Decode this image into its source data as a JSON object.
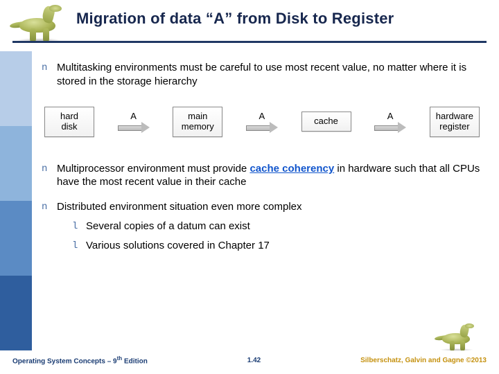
{
  "header": {
    "title": "Migration of data “A” from Disk to Register"
  },
  "bullets": [
    {
      "marker": "n",
      "text": "Multitasking environments must be careful to use most recent value, no matter where it is stored in the storage hierarchy"
    },
    {
      "marker": "n",
      "text_before": "Multiprocessor environment must provide ",
      "link": "cache coherency",
      "text_after": " in hardware such that all CPUs have the most recent value in their cache"
    },
    {
      "marker": "n",
      "text": "Distributed environment situation even more complex",
      "subs": [
        {
          "marker": "l",
          "text": "Several copies of a datum can exist"
        },
        {
          "marker": "l",
          "text": "Various solutions covered in Chapter 17"
        }
      ]
    }
  ],
  "diagram": {
    "boxes": [
      "hard\ndisk",
      "main\nmemory",
      "cache",
      "hardware\nregister"
    ],
    "arrow_label": "A"
  },
  "footer": {
    "left_prefix": "Operating System Concepts – 9",
    "left_super": "th",
    "left_suffix": " Edition",
    "center": "1.42",
    "right": "Silberschatz, Galvin and Gagne ©2013"
  }
}
